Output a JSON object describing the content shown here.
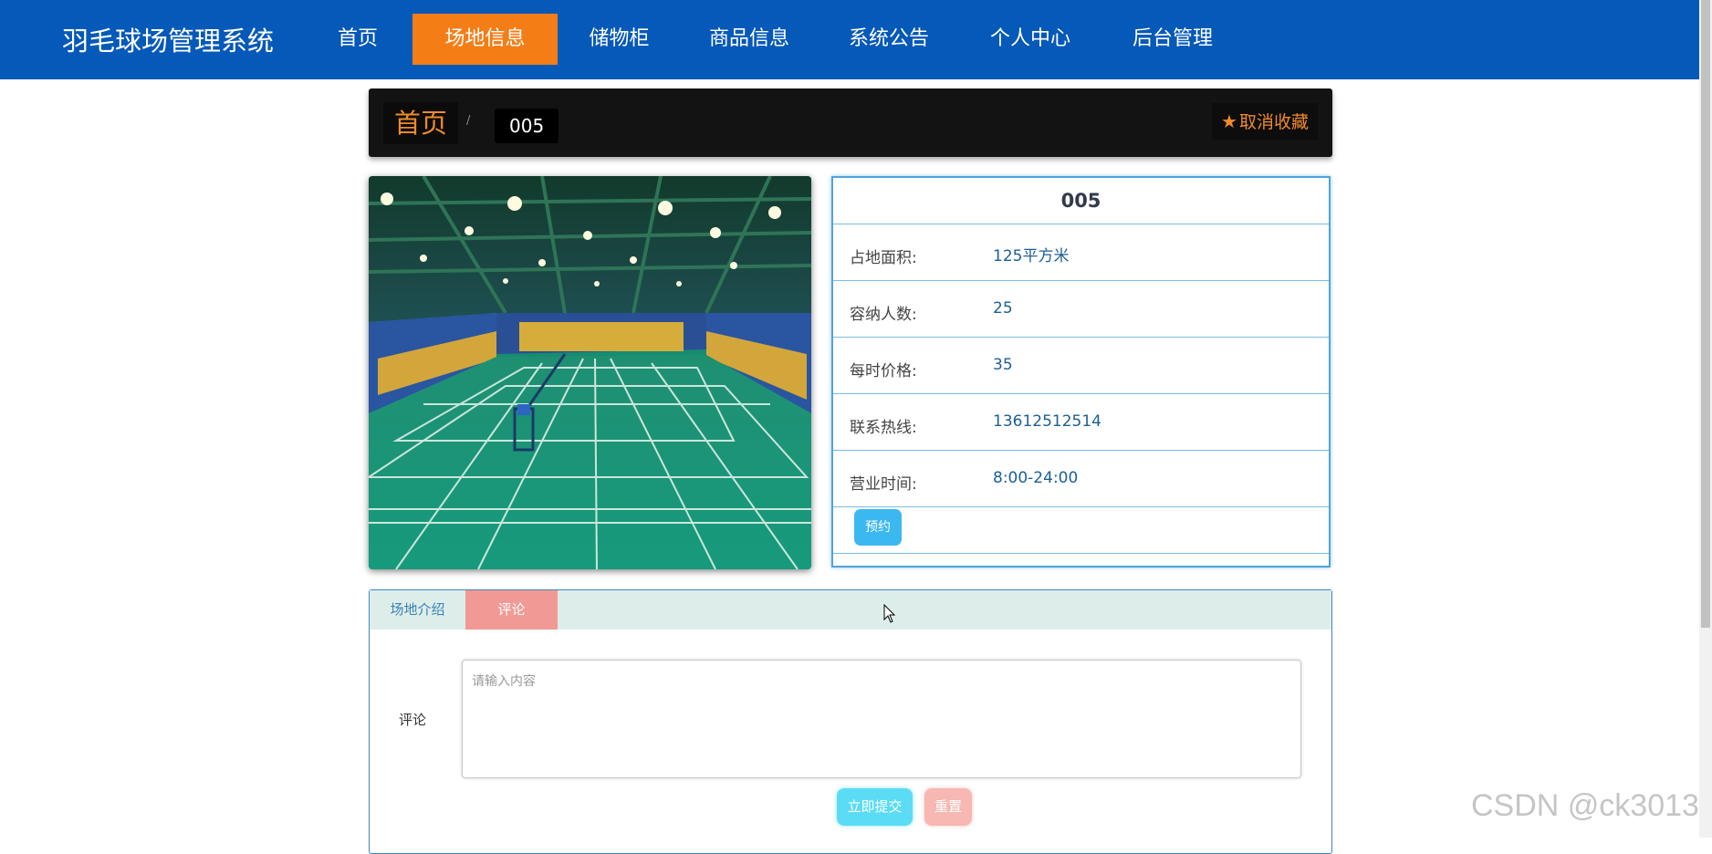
{
  "header": {
    "brand": "羽毛球场管理系统",
    "nav": [
      {
        "label": "首页",
        "active": false
      },
      {
        "label": "场地信息",
        "active": true
      },
      {
        "label": "储物柜",
        "active": false
      },
      {
        "label": "商品信息",
        "active": false
      },
      {
        "label": "系统公告",
        "active": false
      },
      {
        "label": "个人中心",
        "active": false
      },
      {
        "label": "后台管理",
        "active": false
      }
    ]
  },
  "breadcrumb": {
    "home": "首页",
    "separator": "/",
    "current": "005",
    "favorite_label": "取消收藏",
    "favorite_icon": "star-icon"
  },
  "venue": {
    "image_alt": "badminton-court-photo",
    "title": "005",
    "fields": [
      {
        "label": "占地面积:",
        "value": "125平方米"
      },
      {
        "label": "容纳人数:",
        "value": "25"
      },
      {
        "label": "每时价格:",
        "value": "35"
      },
      {
        "label": "联系热线:",
        "value": "13612512514"
      },
      {
        "label": "营业时间:",
        "value": "8:00-24:00"
      }
    ],
    "book_label": "预约"
  },
  "tabs": {
    "items": [
      {
        "label": "场地介绍",
        "active": false
      },
      {
        "label": "评论",
        "active": true
      }
    ]
  },
  "comment_form": {
    "label": "评论",
    "placeholder": "请输入内容",
    "submit_label": "立即提交",
    "reset_label": "重置"
  },
  "watermark": "CSDN @ck3013",
  "colors": {
    "nav_bg": "#0559b8",
    "nav_active": "#f57d16",
    "accent_orange": "#f08a2a",
    "info_border": "#4fa3dd",
    "book_btn": "#3cb8f0",
    "tab_active": "#f19a95",
    "submit_btn": "#5bdcf5",
    "reset_btn": "#f7b7b2"
  }
}
